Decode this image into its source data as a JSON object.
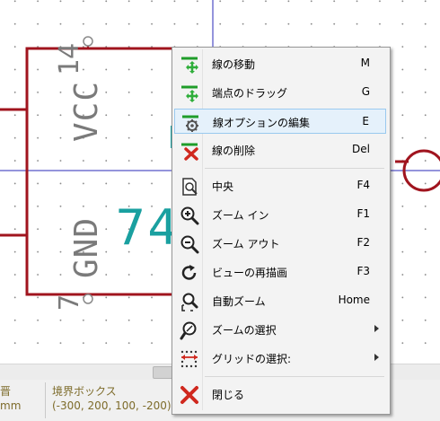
{
  "schematic": {
    "pin_name_top": "VCC",
    "pin_number_top": "14",
    "pin_name_bottom": "GND",
    "pin_number_bottom": "7",
    "reference": "74"
  },
  "status": {
    "units_label": "mm",
    "units_header": "晋",
    "bbox_label": "境界ボックス",
    "bbox_value": "(-300, 200, 100, -200)"
  },
  "menu": {
    "items": [
      {
        "label": "線の移動",
        "shortcut": "M",
        "icon": "move-line-icon"
      },
      {
        "label": "端点のドラッグ",
        "shortcut": "G",
        "icon": "drag-endpoint-icon"
      },
      {
        "label": "線オプションの編集",
        "shortcut": "E",
        "icon": "edit-line-options-icon"
      },
      {
        "label": "線の削除",
        "shortcut": "Del",
        "icon": "delete-line-icon"
      },
      {
        "label": "中央",
        "shortcut": "F4",
        "icon": "center-icon"
      },
      {
        "label": "ズーム イン",
        "shortcut": "F1",
        "icon": "zoom-in-icon"
      },
      {
        "label": "ズーム アウト",
        "shortcut": "F2",
        "icon": "zoom-out-icon"
      },
      {
        "label": "ビューの再描画",
        "shortcut": "F3",
        "icon": "redraw-icon"
      },
      {
        "label": "自動ズーム",
        "shortcut": "Home",
        "icon": "zoom-auto-icon"
      },
      {
        "label": "ズームの選択",
        "shortcut": "",
        "icon": "zoom-select-icon"
      },
      {
        "label": "グリッドの選択:",
        "shortcut": "",
        "icon": "grid-select-icon"
      },
      {
        "label": "閉じる",
        "shortcut": "",
        "icon": "close-icon"
      }
    ]
  }
}
